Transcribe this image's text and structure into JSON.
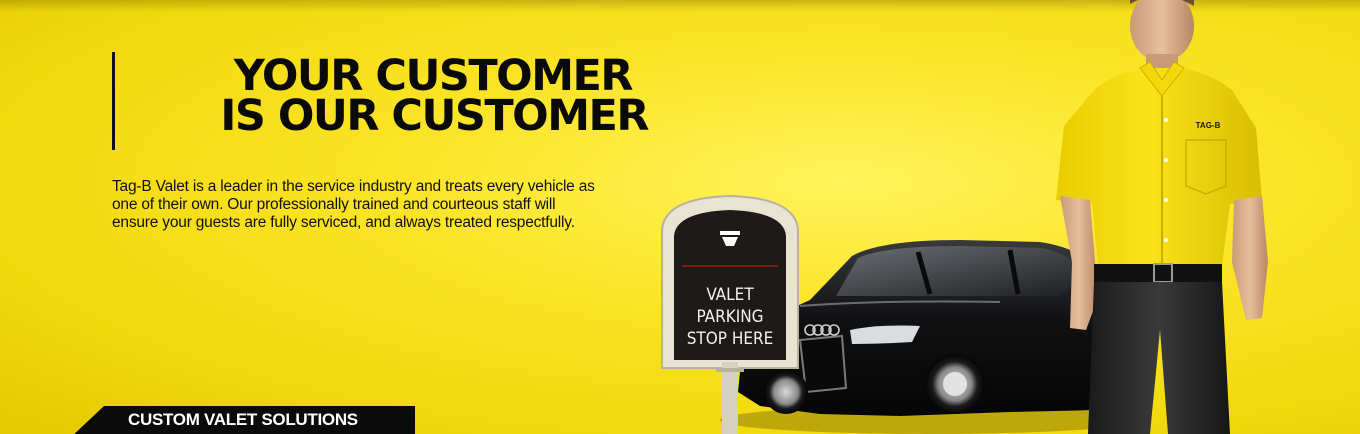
{
  "hero": {
    "headline_line1": "YOUR CUSTOMER",
    "headline_line2": "IS OUR CUSTOMER",
    "description": "Tag-B Valet is a leader in the service industry and treats every vehicle as one of their own.  Our professionally trained and courteous staff will ensure your guests are fully serviced, and always treated respectfully.",
    "ribbon_label": "CUSTOM VALET SOLUTIONS"
  },
  "sign": {
    "line1": "VALET",
    "line2": "PARKING",
    "line3": "STOP HERE"
  },
  "shirt_logo": "TAG-B",
  "colors": {
    "background": "#f7e21a",
    "text": "#0a0a0a",
    "ribbon": "#0b0b0b",
    "sign_board": "#1d1a17"
  },
  "icons": [
    "tag-b-logo-icon"
  ]
}
